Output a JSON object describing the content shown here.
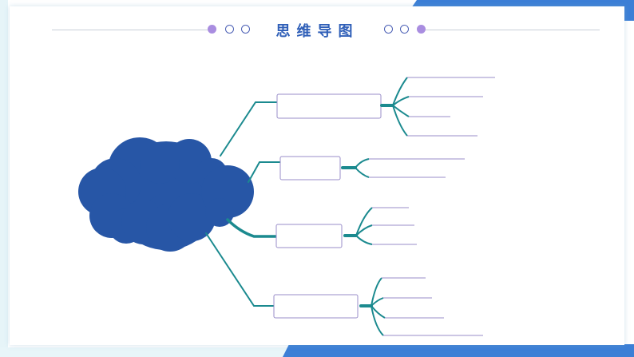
{
  "header": {
    "title": "思维导图"
  },
  "colors": {
    "accent_blue": "#3c7fd6",
    "cloud_fill": "#2756a6",
    "branch_teal": "#1b8a8f",
    "node_border": "#9a8ec9",
    "dot_purple": "#a98de0"
  },
  "mind_map": {
    "central_topic": "",
    "branches": [
      {
        "label": "",
        "leaves": [
          "",
          "",
          "",
          ""
        ]
      },
      {
        "label": "",
        "leaves": [
          "",
          ""
        ]
      },
      {
        "label": "",
        "leaves": [
          "",
          "",
          ""
        ]
      },
      {
        "label": "",
        "leaves": [
          "",
          "",
          "",
          ""
        ]
      }
    ]
  }
}
